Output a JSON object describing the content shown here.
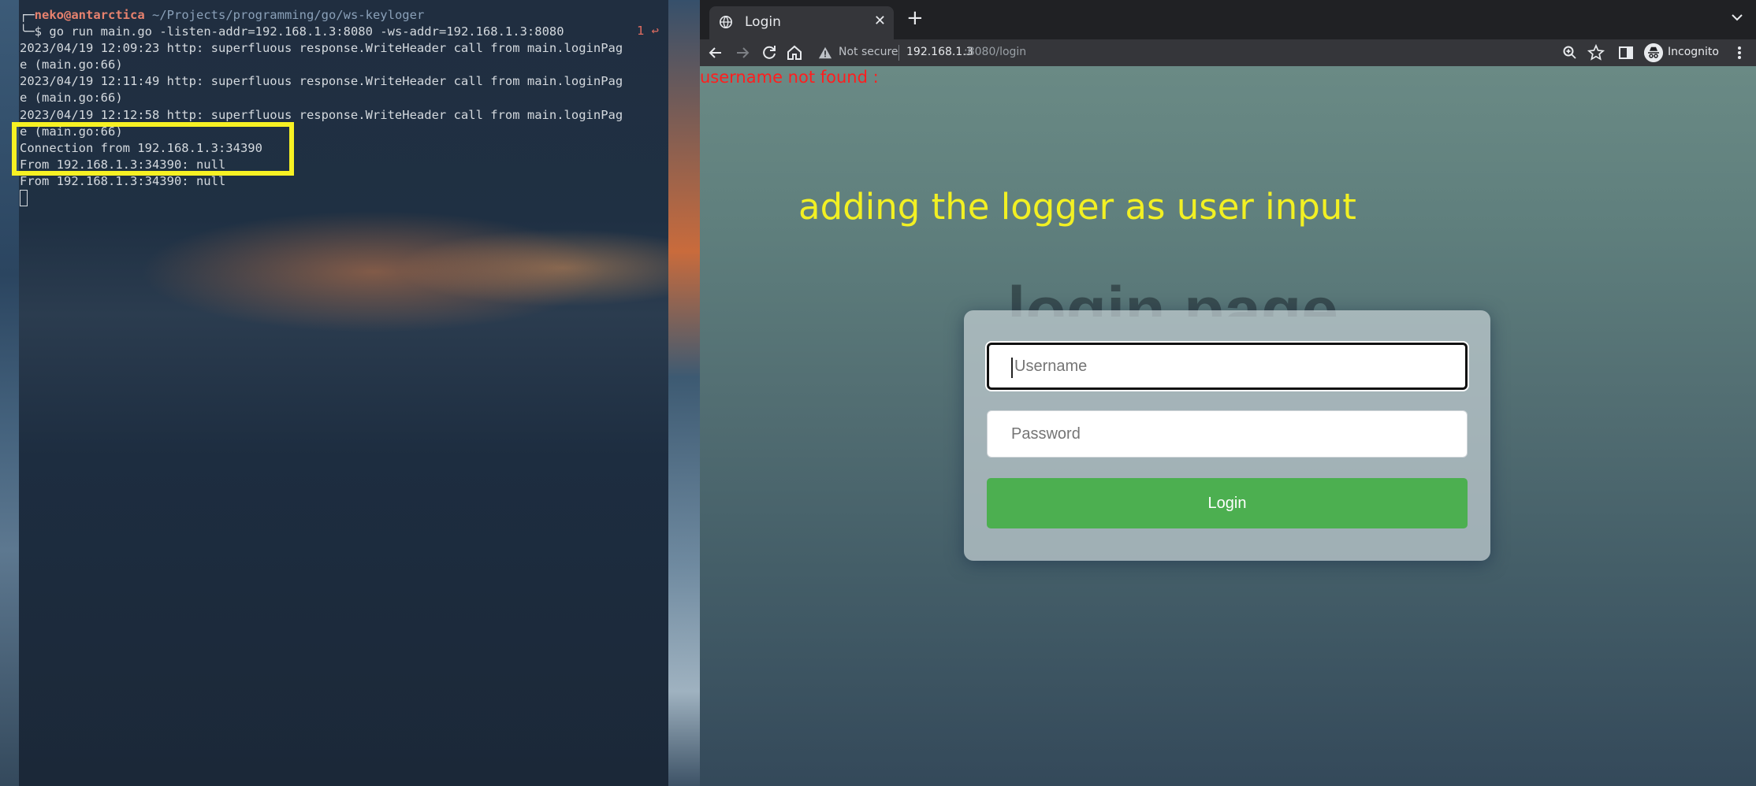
{
  "terminal": {
    "prompt_user": "neko@antarctica",
    "prompt_path": "~/Projects/programming/go/ws-keyloger",
    "prompt_symbol": "$",
    "command": "go run main.go -listen-addr=192.168.1.3:8080 -ws-addr=192.168.1.3:8080",
    "exit_code": "1 ↩",
    "lines": [
      "2023/04/19 12:09:23 http: superfluous response.WriteHeader call from main.loginPag",
      "e (main.go:66)",
      "2023/04/19 12:11:49 http: superfluous response.WriteHeader call from main.loginPag",
      "e (main.go:66)",
      "2023/04/19 12:12:58 http: superfluous response.WriteHeader call from main.loginPag",
      "e (main.go:66)",
      "Connection from 192.168.1.3:34390",
      "From 192.168.1.3:34390: null",
      "From 192.168.1.3:34390: null"
    ],
    "highlight_color": "#f7f123"
  },
  "browser": {
    "tab_title": "Login",
    "url_warning": "Not secure",
    "url_host": "192.168.1.3",
    "url_path": ":8080/login",
    "profile_label": "Incognito",
    "icons": [
      "globe-icon",
      "close-icon",
      "plus-icon",
      "chevron-down-icon",
      "back-arrow-icon",
      "forward-arrow-icon",
      "reload-icon",
      "home-icon",
      "warning-icon",
      "zoom-icon",
      "star-icon",
      "side-panel-icon",
      "incognito-icon",
      "more-vert-icon"
    ]
  },
  "page": {
    "error_message": "username not found :",
    "annotation": "adding the logger as user input",
    "heading": "login page",
    "username_placeholder": "Username",
    "password_placeholder": "Password",
    "login_button": "Login",
    "button_color": "#4caf50",
    "error_color": "#ff1e1e",
    "annotation_color": "#f2f023"
  }
}
